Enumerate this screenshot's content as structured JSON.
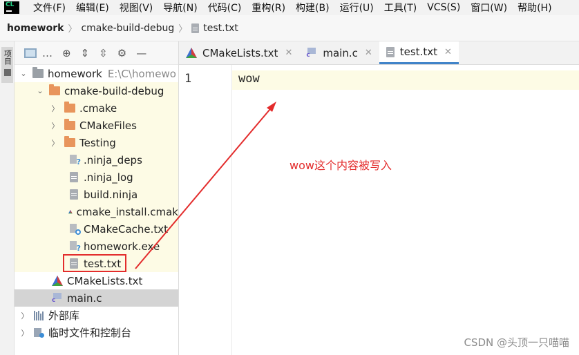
{
  "menu": {
    "logo": "CL",
    "items": [
      "文件(F)",
      "编辑(E)",
      "视图(V)",
      "导航(N)",
      "代码(C)",
      "重构(R)",
      "构建(B)",
      "运行(U)",
      "工具(T)",
      "VCS(S)",
      "窗口(W)",
      "帮助(H)"
    ]
  },
  "breadcrumb": {
    "project": "homework",
    "folder": "cmake-build-debug",
    "file": "test.txt",
    "separator": "〉"
  },
  "toolstrip": {
    "project_tab": "项目"
  },
  "project_panel": {
    "root": {
      "name": "homework",
      "path": "E:\\C\\homewo"
    },
    "build_dir": "cmake-build-debug",
    "folders": [
      ".cmake",
      "CMakeFiles",
      "Testing"
    ],
    "files": [
      ".ninja_deps",
      ".ninja_log",
      "build.ninja",
      "cmake_install.cmak",
      "CMakeCache.txt",
      "homework.exe",
      "test.txt"
    ],
    "root_files": [
      "CMakeLists.txt",
      "main.c"
    ],
    "external_libs": "外部库",
    "scratches": "临时文件和控制台"
  },
  "editor": {
    "tabs": [
      "CMakeLists.txt",
      "main.c",
      "test.txt"
    ],
    "active_tab": "test.txt",
    "close_glyph": "✕",
    "line_number": "1",
    "content": "wow"
  },
  "annotation": "wow这个内容被写入",
  "watermark": "CSDN @头顶一只喵喵",
  "colors": {
    "accent_blue": "#4083c9",
    "folder_orange": "#e8955c",
    "annotation_red": "#e32c2c",
    "current_line": "#fdfbe5"
  }
}
